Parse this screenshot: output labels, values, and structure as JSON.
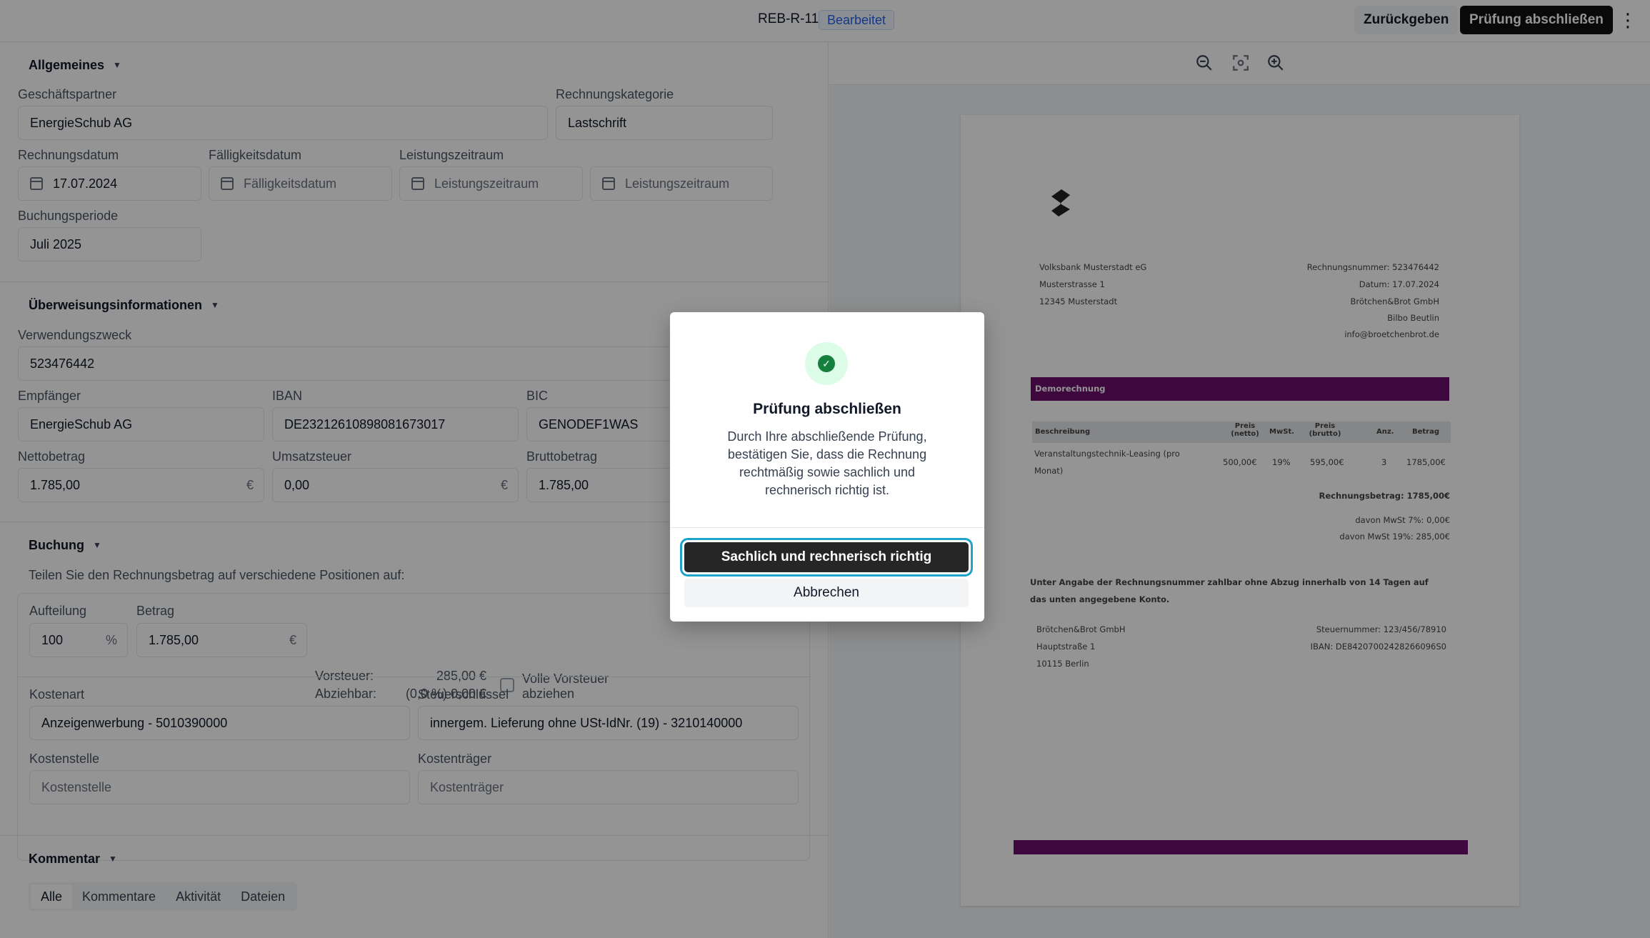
{
  "header": {
    "doc_id": "REB-R-11",
    "status": "Bearbeitet",
    "return_label": "Zurückgeben",
    "finish_label": "Prüfung abschließen",
    "more_icon": "kebab-menu-icon"
  },
  "general": {
    "title": "Allgemeines",
    "partner_label": "Geschäftspartner",
    "partner_value": "EnergieSchub AG",
    "category_label": "Rechnungskategorie",
    "category_value": "Lastschrift",
    "invoice_date_label": "Rechnungsdatum",
    "invoice_date_value": "17.07.2024",
    "due_date_label": "Fälligkeitsdatum",
    "due_date_placeholder": "Fälligkeitsdatum",
    "period_label": "Leistungszeitraum",
    "period_from_placeholder": "Leistungszeitraum",
    "period_to_placeholder": "Leistungszeitraum",
    "booking_period_label": "Buchungsperiode",
    "booking_period_value": "Juli 2025"
  },
  "transfer": {
    "title": "Überweisungsinformationen",
    "purpose_label": "Verwendungszweck",
    "purpose_value": "523476442",
    "recipient_label": "Empfänger",
    "recipient_value": "EnergieSchub AG",
    "iban_label": "IBAN",
    "iban_value": "DE23212610898081673017",
    "bic_label": "BIC",
    "bic_value": "GENODEF1WAS",
    "net_label": "Nettobetrag",
    "net_value": "1.785,00",
    "vat_label": "Umsatzsteuer",
    "vat_value": "0,00",
    "gross_label": "Bruttobetrag",
    "gross_value": "1.785,00",
    "currency": "€"
  },
  "booking": {
    "title": "Buchung",
    "hint": "Teilen Sie den Rechnungsbetrag auf verschiedene Positionen auf:",
    "split_label": "Aufteilung",
    "split_value": "100",
    "split_unit": "%",
    "amount_label": "Betrag",
    "amount_value": "1.785,00",
    "amount_unit": "€",
    "input_tax_label": "Vorsteuer:",
    "input_tax_value": "285,00 €",
    "deductible_label": "Abziehbar:",
    "deductible_value": "(0,0 %) 0,00 €",
    "full_tax_label_1": "Volle Vorsteuer",
    "full_tax_label_2": "abziehen",
    "cost_type_label": "Kostenart",
    "cost_type_value": "Anzeigenwerbung - 5010390000",
    "tax_key_label": "Steuerschlüssel",
    "tax_key_value": "innergem. Lieferung ohne USt-IdNr. (19) - 3210140000",
    "cost_center_label": "Kostenstelle",
    "cost_center_placeholder": "Kostenstelle",
    "cost_unit_label": "Kostenträger",
    "cost_unit_placeholder": "Kostenträger"
  },
  "comments": {
    "title": "Kommentar",
    "tabs": [
      "Alle",
      "Kommentare",
      "Aktivität",
      "Dateien"
    ]
  },
  "viewer": {
    "zoom_out_icon": "zoom-out-icon",
    "fit_icon": "fit-screen-icon",
    "zoom_in_icon": "zoom-in-icon"
  },
  "document": {
    "sender": [
      "Volksbank Musterstadt eG",
      "Musterstrasse 1",
      "12345 Musterstadt"
    ],
    "meta": [
      "Rechnungsnummer: 523476442",
      "Datum: 17.07.2024",
      "Brötchen&Brot GmbH",
      "Bilbo Beutlin",
      "info@broetchenbrot.de"
    ],
    "banner": "Demorechnung",
    "table_headers": [
      "Beschreibung",
      "Preis (netto)",
      "MwSt.",
      "Preis (brutto)",
      "Anz.",
      "Betrag"
    ],
    "row": {
      "desc_1": "Veranstaltungstechnik-Leasing (pro",
      "desc_2": "Monat)",
      "net": "500,00€",
      "vat": "19%",
      "gross": "595,00€",
      "qty": "3",
      "amount": "1785,00€"
    },
    "total": "Rechnungsbetrag: 1785,00€",
    "vat7": "davon MwSt 7%: 0,00€",
    "vat19": "davon MwSt 19%: 285,00€",
    "note_1": "Unter Angabe der Rechnungsnummer zahlbar ohne Abzug innerhalb von 14 Tagen auf",
    "note_2": "das unten angegebene Konto.",
    "footer_left": [
      "Brötchen&Brot GmbH",
      "Hauptstraße 1",
      "10115 Berlin"
    ],
    "footer_right": [
      "Steuernummer: 123/456/78910",
      "IBAN: DE84207002428266096S0"
    ]
  },
  "dialog": {
    "title": "Prüfung abschließen",
    "text": "Durch Ihre abschließende Prüfung, bestätigen Sie, dass die Rechnung rechtmäßig sowie sachlich und rechnerisch richtig ist.",
    "confirm_label": "Sachlich und rechnerisch richtig",
    "cancel_label": "Abbrechen",
    "icon": "check-circle-icon"
  },
  "colors": {
    "accent_blue": "#2563eb",
    "focus_ring": "#1fa3c9",
    "invoice_purple": "#6b0f6b",
    "success_green": "#15803d"
  }
}
